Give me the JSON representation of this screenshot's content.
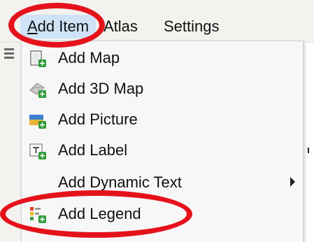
{
  "menubar": {
    "add_item_label": "dd Item",
    "add_item_mnemonic": "A",
    "atlas_label": "Atlas",
    "settings_label": "Settings"
  },
  "dropdown": {
    "items": [
      {
        "label": "Add Map",
        "icon": "map-icon"
      },
      {
        "label": "Add 3D Map",
        "icon": "3d-map-icon"
      },
      {
        "label": "Add Picture",
        "icon": "picture-icon"
      },
      {
        "label": "Add Label",
        "icon": "label-icon"
      },
      {
        "label": "Add Dynamic Text",
        "icon": "dynamic-text-icon",
        "has_submenu": true
      },
      {
        "label": "Add Legend",
        "icon": "legend-icon"
      }
    ]
  },
  "colors": {
    "highlight": "#e5121b",
    "active_menu": "#cfe3f6",
    "plus_badge": "#2e9b3a"
  }
}
